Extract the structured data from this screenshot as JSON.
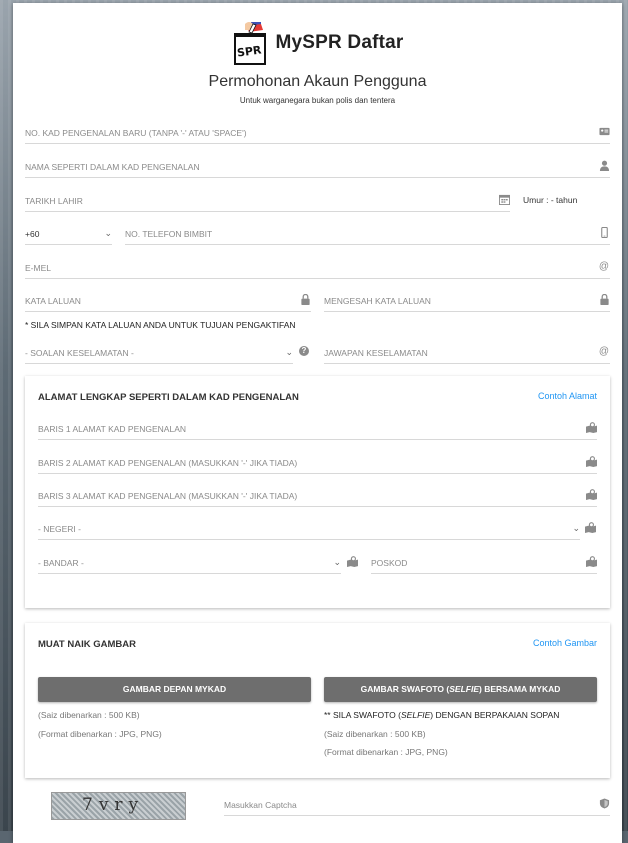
{
  "header": {
    "app_title": "MySPR Daftar",
    "logo_text": "SPR",
    "page_title": "Permohonan Akaun Pengguna",
    "page_subtitle": "Untuk warganegara bukan polis dan tentera"
  },
  "form": {
    "ic_placeholder": "NO. KAD PENGENALAN BARU (TANPA '-' ATAU 'SPACE')",
    "name_placeholder": "NAMA SEPERTI DALAM KAD PENGENALAN",
    "dob_placeholder": "TARIKH LAHIR",
    "age_text": "Umur : - tahun",
    "country_code": "+60",
    "phone_placeholder": "NO. TELEFON BIMBIT",
    "email_placeholder": "E-MEL",
    "password_placeholder": "KATA LALUAN",
    "confirm_password_placeholder": "MENGESAH KATA LALUAN",
    "password_note": "* SILA SIMPAN KATA LALUAN ANDA UNTUK TUJUAN PENGAKTIFAN",
    "security_question": "- SOALAN KESELAMATAN -",
    "security_answer_placeholder": "JAWAPAN KESELAMATAN"
  },
  "address": {
    "title": "ALAMAT LENGKAP SEPERTI DALAM KAD PENGENALAN",
    "example_link": "Contoh Alamat",
    "line1": "BARIS 1 ALAMAT KAD PENGENALAN",
    "line2": "BARIS 2 ALAMAT KAD PENGENALAN (MASUKKAN '-' JIKA TIADA)",
    "line3": "BARIS 3 ALAMAT KAD PENGENALAN (MASUKKAN '-' JIKA TIADA)",
    "state": "- NEGERI -",
    "city": "- BANDAR -",
    "postcode": "POSKOD"
  },
  "upload": {
    "title": "MUAT NAIK GAMBAR",
    "example_link": "Contoh Gambar",
    "front_button": "GAMBAR DEPAN MYKAD",
    "selfie_button_pre": "GAMBAR SWAFOTO (",
    "selfie_button_em": "SELFIE",
    "selfie_button_post": ") BERSAMA MYKAD",
    "size_note": "(Saiz dibenarkan : 500 KB)",
    "format_note": "(Format dibenarkan : JPG, PNG)",
    "selfie_note_pre": "** SILA SWAFOTO (",
    "selfie_note_em": "SELFIE",
    "selfie_note_post": ") DENGAN BERPAKAIAN SOPAN"
  },
  "captcha": {
    "image_text": "7vry",
    "placeholder": "Masukkan Captcha"
  },
  "colors": {
    "accent": "#2196f3",
    "button": "#6e6e6e"
  }
}
